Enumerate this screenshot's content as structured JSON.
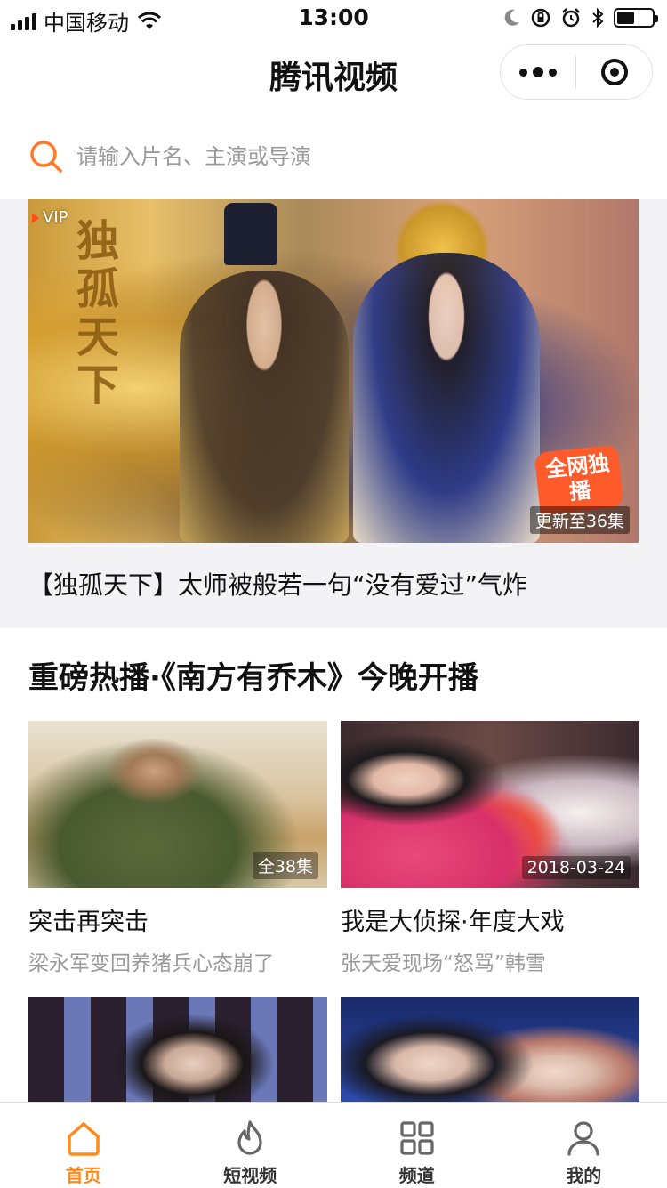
{
  "status_bar": {
    "carrier": "中国移动",
    "time": "13:00"
  },
  "nav": {
    "title": "腾讯视频"
  },
  "search": {
    "placeholder": "请输入片名、主演或导演"
  },
  "banner": {
    "vip_label": "VIP",
    "artwork_title": "独孤天下",
    "exclusive_label": "全网独播",
    "update_badge": "更新至36集",
    "caption": "【独孤天下】太师被般若一句“没有爱过”气炸"
  },
  "section": {
    "title": "重磅热播·《南方有乔木》今晚开播",
    "cards": [
      {
        "title": "突击再突击",
        "desc": "梁永军变回养猪兵心态崩了",
        "badge": "全38集"
      },
      {
        "title": "我是大侦探·年度大戏",
        "desc": "张天爱现场“怒骂”韩雪",
        "badge": "2018-03-24"
      },
      {
        "title": "",
        "desc": "",
        "badge": ""
      },
      {
        "title": "",
        "desc": "",
        "badge": ""
      }
    ]
  },
  "tab_bar": {
    "items": [
      {
        "label": "首页",
        "icon": "home-icon",
        "active": true
      },
      {
        "label": "短视频",
        "icon": "flame-icon",
        "active": false
      },
      {
        "label": "频道",
        "icon": "grid-icon",
        "active": false
      },
      {
        "label": "我的",
        "icon": "user-icon",
        "active": false
      }
    ]
  },
  "colors": {
    "accent": "#ff8a1a",
    "search_icon": "#ff7a2a",
    "muted_text": "#9a9a9a"
  }
}
